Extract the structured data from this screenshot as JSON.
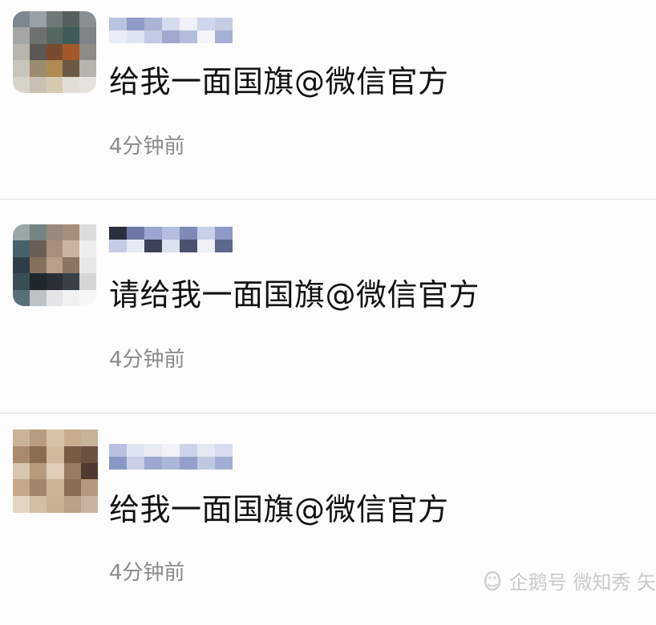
{
  "posts": [
    {
      "text": "给我一面国旗@微信官方",
      "time": "4分钟前",
      "avatar_colors": [
        "#7d8792",
        "#9aa2a8",
        "#6f7a78",
        "#55605e",
        "#8a8f94",
        "#a3a6a3",
        "#6d7270",
        "#566660",
        "#3f5b5a",
        "#7e8487",
        "#b9b5ae",
        "#5b5752",
        "#7a4a2e",
        "#a4582a",
        "#8e8a86",
        "#c9c4bc",
        "#9c8b70",
        "#b08a55",
        "#6b5a43",
        "#b7b4ae",
        "#d8d4cc",
        "#c8c1b3",
        "#d7c9b0",
        "#e2ddd4",
        "#e6e3de"
      ],
      "nickname_colors": [
        "#b9c4e2",
        "#e9edf6",
        "#8e9cc7",
        "#dfe4f1",
        "#aab3d6",
        "#c3cae3",
        "#d5dbee",
        "#9fa9cf",
        "#eef1f8",
        "#b4bedc",
        "#cfd5ea",
        "#f3f5fa",
        "#c5cce4",
        "#a6b0d2"
      ]
    },
    {
      "text": "请给我一面国旗@微信官方",
      "time": "4分钟前",
      "avatar_colors": [
        "#9aa6a8",
        "#778486",
        "#9a8a7d",
        "#a68e7c",
        "#dcdcdc",
        "#48606a",
        "#6b5e57",
        "#a88f7c",
        "#c8b4a1",
        "#eeeeee",
        "#2f3d46",
        "#84705f",
        "#b8a08b",
        "#8a7565",
        "#e8e8e8",
        "#3a4d55",
        "#1f262c",
        "#2a2f35",
        "#3b4147",
        "#d6d6d6",
        "#5a6e78",
        "#bcc3c7",
        "#e3e5e6",
        "#f1f1f1",
        "#f7f7f7"
      ],
      "nickname_colors": [
        "#2a2f3f",
        "#c4cce6",
        "#6c78a3",
        "#e6eaf5",
        "#9aa6cf",
        "#3c4257",
        "#b3bde0",
        "#dde2f1",
        "#7d89b6",
        "#4a5270",
        "#c9d0e9",
        "#eef1f8",
        "#8f9bc6",
        "#5d678c"
      ]
    },
    {
      "text": "给我一面国旗@微信官方",
      "time": "4分钟前",
      "avatar_colors": [
        "#c9b49b",
        "#b89c7f",
        "#d6c2a6",
        "#c7ad8d",
        "#c7b29a",
        "#a98a6e",
        "#8d6c52",
        "#d0b89a",
        "#7a5a44",
        "#6c5140",
        "#d9c6ae",
        "#b79a7c",
        "#e0cfb8",
        "#9a7a60",
        "#4e3a2f",
        "#c4a88a",
        "#a3846a",
        "#cdb497",
        "#8a6b55",
        "#b4977c",
        "#e3d6c4",
        "#d2bea4",
        "#c9b193",
        "#b9a086",
        "#c7b4a0"
      ],
      "nickname_colors": [
        "#b8c2e0",
        "#8997c4",
        "#dfe4f1",
        "#c9d0e8",
        "#e8ebf4",
        "#9ca8d0",
        "#f1f3f8",
        "#adb7da",
        "#cdd4ea",
        "#93a0cb",
        "#e4e8f3",
        "#bfc8e3",
        "#d7dcee",
        "#a3aed4"
      ]
    }
  ],
  "watermark": {
    "text": "企鹅号 微知秀 矢",
    "color": "#c9c9c9"
  },
  "colors": {
    "background": "#fdfdfe",
    "divider": "#dcdcdc",
    "comment_text": "#111111",
    "timestamp_text": "#8a8a8a"
  },
  "icons": {
    "watermark_logo": "penguin-logo-icon"
  }
}
